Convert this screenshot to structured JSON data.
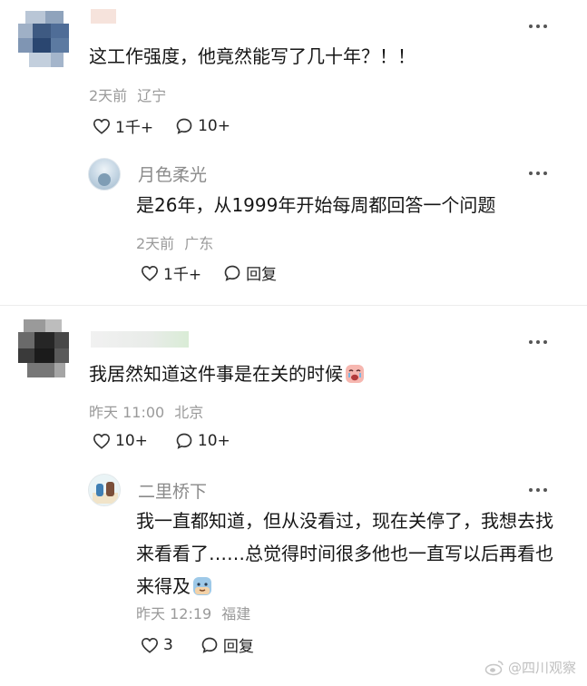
{
  "comments": [
    {
      "text": "这工作强度，他竟然能写了几十年？！！",
      "time": "2天前",
      "location": "辽宁",
      "likes": "1千+",
      "replies": "10+",
      "reply": {
        "username": "月色柔光",
        "text": "是26年，从1999年开始每周都回答一个问题",
        "time": "2天前",
        "location": "广东",
        "likes": "1千+",
        "reply_label": "回复"
      }
    },
    {
      "text": "我居然知道这件事是在关的时候",
      "time": "昨天 11:00",
      "location": "北京",
      "likes": "10+",
      "replies": "10+",
      "reply": {
        "username": "二里桥下",
        "text": "我一直都知道，但从没看过，现在关停了，我想去找来看看了……总觉得时间很多他也一直写以后再看也来得及",
        "time": "昨天 12:19",
        "location": "福建",
        "likes": "3",
        "reply_label": "回复"
      }
    }
  ],
  "watermark": "@四川观察",
  "icons": {
    "like": "heart-outline-icon",
    "comment": "speech-bubble-icon",
    "more": "more-dots-icon"
  }
}
